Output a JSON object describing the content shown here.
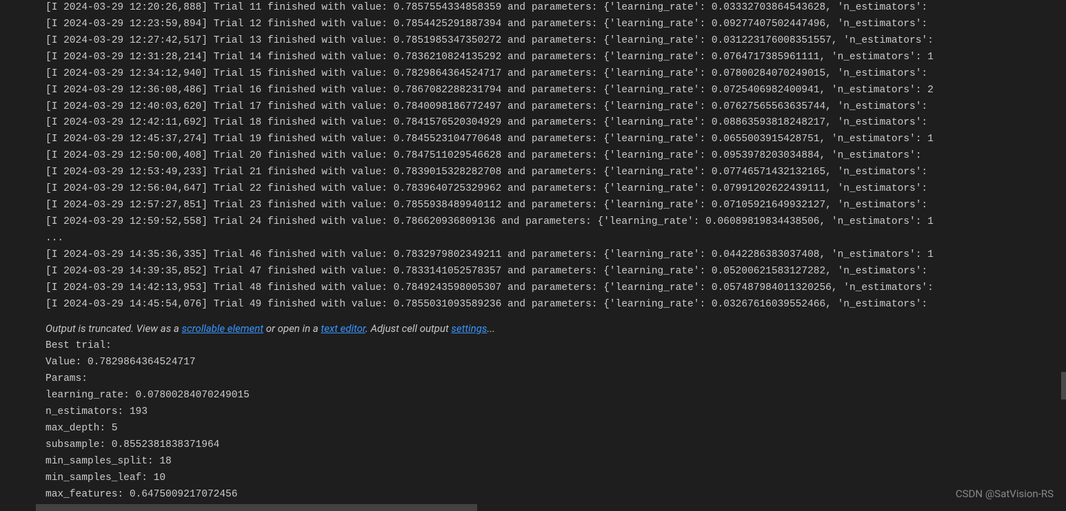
{
  "log_lines": [
    "[I 2024-03-29 12:20:26,888] Trial 11 finished with value: 0.7857554334858359 and parameters: {'learning_rate': 0.03332703864543628, 'n_estimators':",
    "[I 2024-03-29 12:23:59,894] Trial 12 finished with value: 0.7854425291887394 and parameters: {'learning_rate': 0.09277407502447496, 'n_estimators':",
    "[I 2024-03-29 12:27:42,517] Trial 13 finished with value: 0.7851985347350272 and parameters: {'learning_rate': 0.031223176008351557, 'n_estimators':",
    "[I 2024-03-29 12:31:28,214] Trial 14 finished with value: 0.7836210824135292 and parameters: {'learning_rate': 0.0764717385961111, 'n_estimators': 1",
    "[I 2024-03-29 12:34:12,940] Trial 15 finished with value: 0.7829864364524717 and parameters: {'learning_rate': 0.07800284070249015, 'n_estimators':",
    "[I 2024-03-29 12:36:08,486] Trial 16 finished with value: 0.7867082288231794 and parameters: {'learning_rate': 0.0725406982400941, 'n_estimators': 2",
    "[I 2024-03-29 12:40:03,620] Trial 17 finished with value: 0.7840098186772497 and parameters: {'learning_rate': 0.07627565563635744, 'n_estimators':",
    "[I 2024-03-29 12:42:11,692] Trial 18 finished with value: 0.7841576520304929 and parameters: {'learning_rate': 0.08863593818248217, 'n_estimators':",
    "[I 2024-03-29 12:45:37,274] Trial 19 finished with value: 0.7845523104770648 and parameters: {'learning_rate': 0.0655003915428751, 'n_estimators': 1",
    "[I 2024-03-29 12:50:00,408] Trial 20 finished with value: 0.7847511029546628 and parameters: {'learning_rate': 0.0953978203034884, 'n_estimators':",
    "[I 2024-03-29 12:53:49,233] Trial 21 finished with value: 0.7839015328282708 and parameters: {'learning_rate': 0.07746571432132165, 'n_estimators':",
    "[I 2024-03-29 12:56:04,647] Trial 22 finished with value: 0.7839640725329962 and parameters: {'learning_rate': 0.07991202622439111, 'n_estimators':",
    "[I 2024-03-29 12:57:27,851] Trial 23 finished with value: 0.7855938489940112 and parameters: {'learning_rate': 0.07105921649932127, 'n_estimators':",
    "[I 2024-03-29 12:59:52,558] Trial 24 finished with value: 0.786620936809136 and parameters: {'learning_rate': 0.06089819834438506, 'n_estimators': 1",
    "...",
    "[I 2024-03-29 14:35:36,335] Trial 46 finished with value: 0.7832979802349211 and parameters: {'learning_rate': 0.0442286383037408, 'n_estimators': 1",
    "[I 2024-03-29 14:39:35,852] Trial 47 finished with value: 0.7833141052578357 and parameters: {'learning_rate': 0.05200621583127282, 'n_estimators':",
    "[I 2024-03-29 14:42:13,953] Trial 48 finished with value: 0.7849243598005307 and parameters: {'learning_rate': 0.057487984011320256, 'n_estimators':",
    "[I 2024-03-29 14:45:54,076] Trial 49 finished with value: 0.7855031093589236 and parameters: {'learning_rate': 0.03267616039552466, 'n_estimators':"
  ],
  "truncate": {
    "prefix": "Output is truncated. View as a ",
    "link1": "scrollable element",
    "mid1": " or open in a ",
    "link2": "text editor",
    "mid2": ". Adjust cell output ",
    "link3": "settings",
    "suffix": "..."
  },
  "results": [
    "Best trial:",
    "Value: 0.7829864364524717",
    "Params:",
    "learning_rate: 0.07800284070249015",
    "n_estimators: 193",
    "max_depth: 5",
    "subsample: 0.8552381838371964",
    "min_samples_split: 18",
    "min_samples_leaf: 10",
    "max_features: 0.6475009217072456"
  ],
  "watermark": "CSDN @SatVision-RS"
}
